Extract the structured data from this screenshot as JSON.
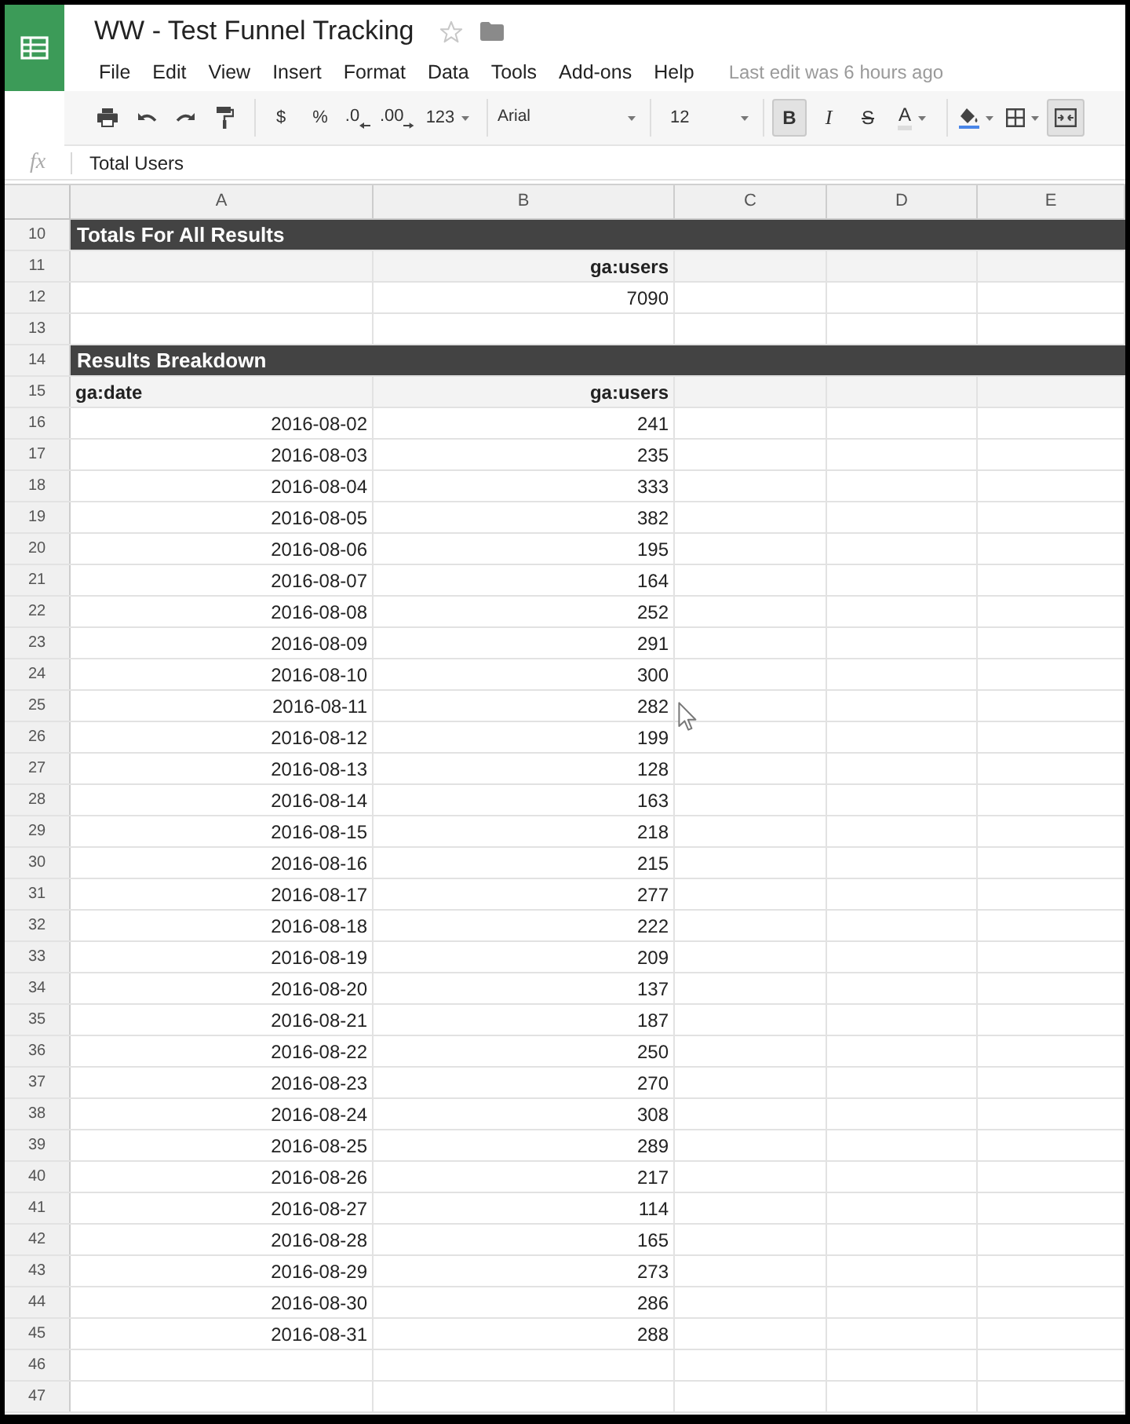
{
  "app": {
    "title": "WW - Test Funnel Tracking",
    "starred": false,
    "last_edit": "Last edit was 6 hours ago"
  },
  "menu": [
    "File",
    "Edit",
    "View",
    "Insert",
    "Format",
    "Data",
    "Tools",
    "Add-ons",
    "Help"
  ],
  "toolbar": [
    {
      "kind": "print",
      "pressed": false
    },
    {
      "kind": "undo",
      "pressed": false
    },
    {
      "kind": "redo",
      "pressed": false
    },
    {
      "kind": "paint-format",
      "pressed": false
    },
    {
      "kind": "separator"
    },
    {
      "kind": "currency",
      "label": "$",
      "pressed": false
    },
    {
      "kind": "percent",
      "label": "%",
      "pressed": false
    },
    {
      "kind": "decimal-decrease",
      "label": ".0",
      "pressed": false
    },
    {
      "kind": "decimal-increase",
      "label": ".00",
      "pressed": false
    },
    {
      "kind": "number-format",
      "label": "123",
      "pressed": false
    },
    {
      "kind": "separator"
    },
    {
      "kind": "font",
      "label": "Arial",
      "pressed": false
    },
    {
      "kind": "separator"
    },
    {
      "kind": "font-size",
      "label": "12",
      "pressed": false
    },
    {
      "kind": "separator"
    },
    {
      "kind": "bold",
      "label": "B",
      "pressed": true
    },
    {
      "kind": "italic",
      "label": "I",
      "pressed": false
    },
    {
      "kind": "strikethrough",
      "label": "S",
      "pressed": false
    },
    {
      "kind": "text-color",
      "label": "A",
      "pressed": false
    },
    {
      "kind": "separator"
    },
    {
      "kind": "fill-color",
      "pressed": false
    },
    {
      "kind": "borders",
      "pressed": false
    },
    {
      "kind": "merge",
      "pressed": true
    }
  ],
  "formula_bar": {
    "label": "fx",
    "value": "Total Users"
  },
  "sheet": {
    "columns": [
      "A",
      "B",
      "C",
      "D",
      "E"
    ],
    "rows": [
      {
        "number": "10",
        "kind": "section",
        "title": "Totals For All Results"
      },
      {
        "number": "11",
        "kind": "header",
        "label_b": "ga:users"
      },
      {
        "number": "12",
        "kind": "data",
        "b": "7090"
      },
      {
        "number": "13",
        "kind": "blank"
      },
      {
        "number": "14",
        "kind": "section",
        "title": "Results Breakdown"
      },
      {
        "number": "15",
        "kind": "header",
        "label_a": "ga:date",
        "label_b": "ga:users"
      },
      {
        "number": "16",
        "kind": "data",
        "a": "2016-08-02",
        "b": "241"
      },
      {
        "number": "17",
        "kind": "data",
        "a": "2016-08-03",
        "b": "235"
      },
      {
        "number": "18",
        "kind": "data",
        "a": "2016-08-04",
        "b": "333"
      },
      {
        "number": "19",
        "kind": "data",
        "a": "2016-08-05",
        "b": "382"
      },
      {
        "number": "20",
        "kind": "data",
        "a": "2016-08-06",
        "b": "195"
      },
      {
        "number": "21",
        "kind": "data",
        "a": "2016-08-07",
        "b": "164"
      },
      {
        "number": "22",
        "kind": "data",
        "a": "2016-08-08",
        "b": "252"
      },
      {
        "number": "23",
        "kind": "data",
        "a": "2016-08-09",
        "b": "291"
      },
      {
        "number": "24",
        "kind": "data",
        "a": "2016-08-10",
        "b": "300"
      },
      {
        "number": "25",
        "kind": "data",
        "a": "2016-08-11",
        "b": "282"
      },
      {
        "number": "26",
        "kind": "data",
        "a": "2016-08-12",
        "b": "199"
      },
      {
        "number": "27",
        "kind": "data",
        "a": "2016-08-13",
        "b": "128"
      },
      {
        "number": "28",
        "kind": "data",
        "a": "2016-08-14",
        "b": "163"
      },
      {
        "number": "29",
        "kind": "data",
        "a": "2016-08-15",
        "b": "218"
      },
      {
        "number": "30",
        "kind": "data",
        "a": "2016-08-16",
        "b": "215"
      },
      {
        "number": "31",
        "kind": "data",
        "a": "2016-08-17",
        "b": "277"
      },
      {
        "number": "32",
        "kind": "data",
        "a": "2016-08-18",
        "b": "222"
      },
      {
        "number": "33",
        "kind": "data",
        "a": "2016-08-19",
        "b": "209"
      },
      {
        "number": "34",
        "kind": "data",
        "a": "2016-08-20",
        "b": "137"
      },
      {
        "number": "35",
        "kind": "data",
        "a": "2016-08-21",
        "b": "187"
      },
      {
        "number": "36",
        "kind": "data",
        "a": "2016-08-22",
        "b": "250"
      },
      {
        "number": "37",
        "kind": "data",
        "a": "2016-08-23",
        "b": "270"
      },
      {
        "number": "38",
        "kind": "data",
        "a": "2016-08-24",
        "b": "308"
      },
      {
        "number": "39",
        "kind": "data",
        "a": "2016-08-25",
        "b": "289"
      },
      {
        "number": "40",
        "kind": "data",
        "a": "2016-08-26",
        "b": "217"
      },
      {
        "number": "41",
        "kind": "data",
        "a": "2016-08-27",
        "b": "114"
      },
      {
        "number": "42",
        "kind": "data",
        "a": "2016-08-28",
        "b": "165"
      },
      {
        "number": "43",
        "kind": "data",
        "a": "2016-08-29",
        "b": "273"
      },
      {
        "number": "44",
        "kind": "data",
        "a": "2016-08-30",
        "b": "286"
      },
      {
        "number": "45",
        "kind": "data",
        "a": "2016-08-31",
        "b": "288"
      },
      {
        "number": "46",
        "kind": "blank"
      },
      {
        "number": "47",
        "kind": "blank"
      }
    ]
  }
}
